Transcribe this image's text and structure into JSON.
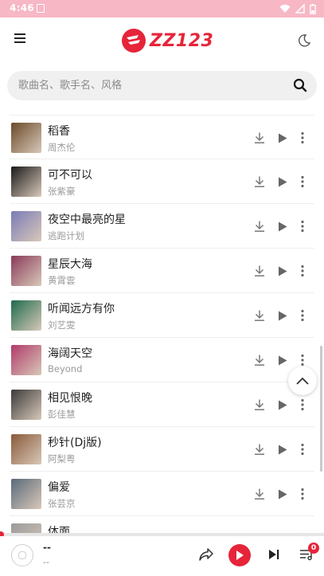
{
  "status_bar": {
    "time": "4:46",
    "icons": [
      "notification-icon",
      "wifi-icon",
      "signal-icon",
      "battery-icon"
    ]
  },
  "header": {
    "logo_text": "ZZ123",
    "menu_icon": "hamburger-menu-icon",
    "theme_icon": "moon-icon"
  },
  "search": {
    "placeholder": "歌曲名、歌手名、风格",
    "value": ""
  },
  "songs": [
    {
      "title": "稻香",
      "artist": "周杰伦",
      "cover_color": "#6b4a2a"
    },
    {
      "title": "可不可以",
      "artist": "张紫豪",
      "cover_color": "#1a1a1a"
    },
    {
      "title": "夜空中最亮的星",
      "artist": "逃跑计划",
      "cover_color": "#7a7bb8"
    },
    {
      "title": "星辰大海",
      "artist": "黄霄雲",
      "cover_color": "#8a3a5a"
    },
    {
      "title": "听闻远方有你",
      "artist": "刘艺雯",
      "cover_color": "#1e6b4e"
    },
    {
      "title": "海阔天空",
      "artist": "Beyond",
      "cover_color": "#b03a6a"
    },
    {
      "title": "相见恨晚",
      "artist": "彭佳慧",
      "cover_color": "#3a3a3a"
    },
    {
      "title": "秒针(Dj版)",
      "artist": "阿梨粤",
      "cover_color": "#8a5a3a"
    },
    {
      "title": "偏爱",
      "artist": "张芸京",
      "cover_color": "#5a6a7a"
    },
    {
      "title": "体面",
      "artist": "",
      "cover_color": "#9a9a9a"
    }
  ],
  "player": {
    "title": "--",
    "artist": "--",
    "queue_count": "0",
    "accent": "#e6243a"
  }
}
